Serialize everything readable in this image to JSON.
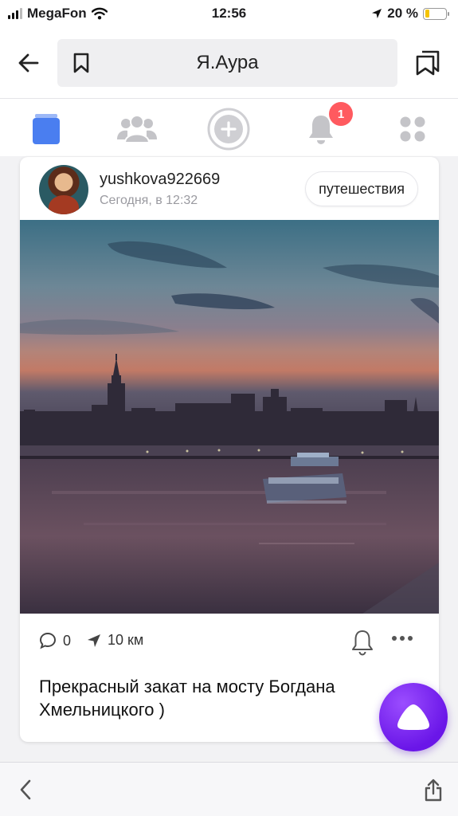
{
  "status_bar": {
    "carrier": "MegaFon",
    "time": "12:56",
    "battery_percent": "20 %",
    "battery_level": 0.2
  },
  "header": {
    "title": "Я.Аура",
    "icons": [
      "arrow-left-icon",
      "bookmark-icon",
      "collections-icon"
    ]
  },
  "tabs": {
    "items": [
      "feed-icon",
      "people-icon",
      "plus-circle-icon",
      "bell-icon",
      "apps-grid-icon"
    ],
    "notification_badge": "1",
    "active_color": "#4a7ef0"
  },
  "post": {
    "username": "yushkova922669",
    "time": "Сегодня, в 12:32",
    "tag": "путешествия",
    "comments": "0",
    "distance": "10 км",
    "text": "Прекрасный закат на мосту Богдана Хмельницкого )"
  },
  "colors": {
    "alice_purple": "#7b2cf2",
    "badge_red": "#ff5a5f"
  }
}
